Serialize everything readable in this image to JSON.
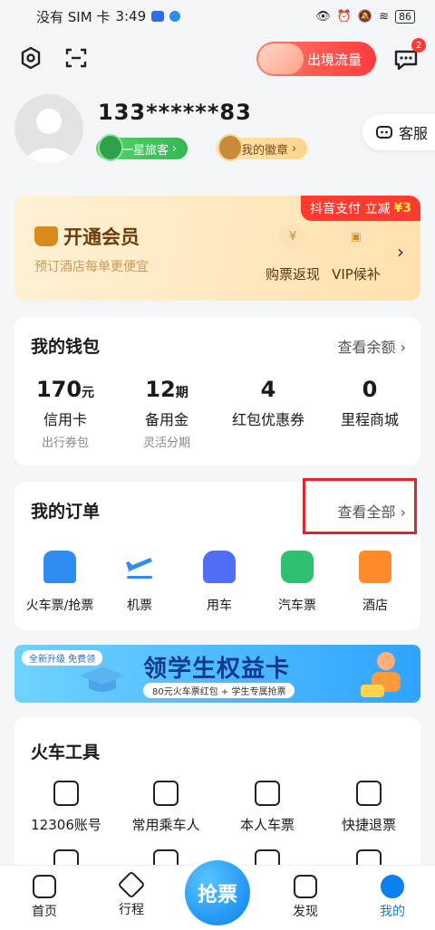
{
  "status_bar": {
    "carrier": "没有 SIM 卡",
    "time": "3:49",
    "battery": "86"
  },
  "top_bar": {
    "flow_label": "出境流量",
    "message_count": "2"
  },
  "profile": {
    "phone": "133******83",
    "level_tag": "一星旅客",
    "badge_tag": "我的徽章",
    "service_label": "客服"
  },
  "vip": {
    "promo_text": "抖音支付 立减",
    "promo_amount": "¥3",
    "title": "开通会员",
    "subtitle": "预订酒店每单更便宜",
    "feature_1": "购票返现",
    "feature_2": "VIP候补"
  },
  "wallet": {
    "title": "我的钱包",
    "link": "查看余额",
    "items": [
      {
        "num": "170",
        "unit": "元",
        "label": "信用卡",
        "sub": "出行券包"
      },
      {
        "num": "12",
        "unit": "期",
        "label": "备用金",
        "sub": "灵活分期"
      },
      {
        "num": "4",
        "unit": "",
        "label": "红包优惠券",
        "sub": ""
      },
      {
        "num": "0",
        "unit": "",
        "label": "里程商城",
        "sub": ""
      }
    ]
  },
  "orders": {
    "title": "我的订单",
    "link": "查看全部",
    "items": [
      {
        "label": "火车票/抢票",
        "color": "#2f8cf0"
      },
      {
        "label": "机票",
        "color": "#2f8cf0"
      },
      {
        "label": "用车",
        "color": "#4f6df5"
      },
      {
        "label": "汽车票",
        "color": "#2fbf71"
      },
      {
        "label": "酒店",
        "color": "#ff8a2a"
      }
    ]
  },
  "banner": {
    "tag": "全新升级 免费领",
    "title": "领学生权益卡",
    "subtitle": "80元火车票红包 + 学生专属抢票"
  },
  "tools": {
    "title": "火车工具",
    "items": [
      "12306账号",
      "常用乘车人",
      "本人车票",
      "快捷退票"
    ]
  },
  "tabs": {
    "home": "首页",
    "trip": "行程",
    "grab": "抢票",
    "discover": "发现",
    "mine": "我的"
  },
  "colors": {
    "accent": "#0b7ff0",
    "highlight": "#e3242b"
  }
}
